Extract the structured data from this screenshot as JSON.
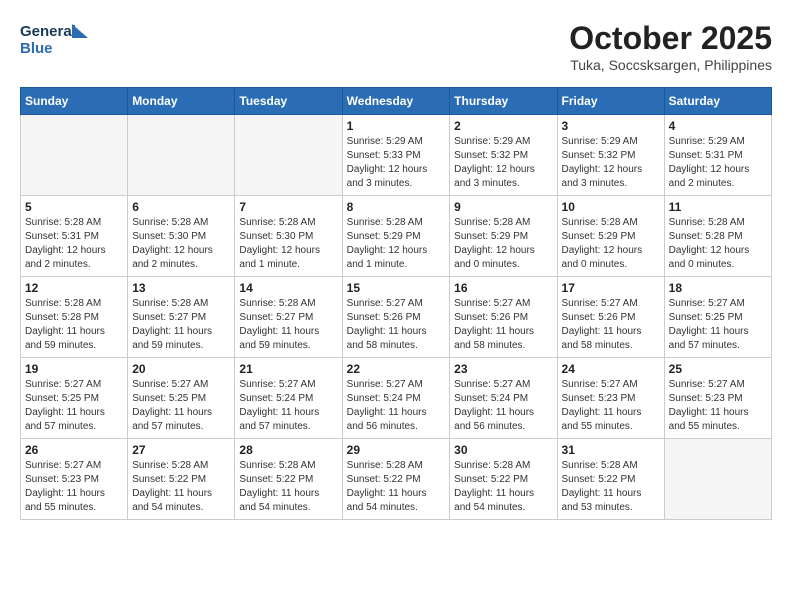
{
  "logo": {
    "line1": "General",
    "line2": "Blue"
  },
  "title": "October 2025",
  "subtitle": "Tuka, Soccsksargen, Philippines",
  "days_of_week": [
    "Sunday",
    "Monday",
    "Tuesday",
    "Wednesday",
    "Thursday",
    "Friday",
    "Saturday"
  ],
  "weeks": [
    [
      {
        "day": null,
        "info": null
      },
      {
        "day": null,
        "info": null
      },
      {
        "day": null,
        "info": null
      },
      {
        "day": "1",
        "info": "Sunrise: 5:29 AM\nSunset: 5:33 PM\nDaylight: 12 hours\nand 3 minutes."
      },
      {
        "day": "2",
        "info": "Sunrise: 5:29 AM\nSunset: 5:32 PM\nDaylight: 12 hours\nand 3 minutes."
      },
      {
        "day": "3",
        "info": "Sunrise: 5:29 AM\nSunset: 5:32 PM\nDaylight: 12 hours\nand 3 minutes."
      },
      {
        "day": "4",
        "info": "Sunrise: 5:29 AM\nSunset: 5:31 PM\nDaylight: 12 hours\nand 2 minutes."
      }
    ],
    [
      {
        "day": "5",
        "info": "Sunrise: 5:28 AM\nSunset: 5:31 PM\nDaylight: 12 hours\nand 2 minutes."
      },
      {
        "day": "6",
        "info": "Sunrise: 5:28 AM\nSunset: 5:30 PM\nDaylight: 12 hours\nand 2 minutes."
      },
      {
        "day": "7",
        "info": "Sunrise: 5:28 AM\nSunset: 5:30 PM\nDaylight: 12 hours\nand 1 minute."
      },
      {
        "day": "8",
        "info": "Sunrise: 5:28 AM\nSunset: 5:29 PM\nDaylight: 12 hours\nand 1 minute."
      },
      {
        "day": "9",
        "info": "Sunrise: 5:28 AM\nSunset: 5:29 PM\nDaylight: 12 hours\nand 0 minutes."
      },
      {
        "day": "10",
        "info": "Sunrise: 5:28 AM\nSunset: 5:29 PM\nDaylight: 12 hours\nand 0 minutes."
      },
      {
        "day": "11",
        "info": "Sunrise: 5:28 AM\nSunset: 5:28 PM\nDaylight: 12 hours\nand 0 minutes."
      }
    ],
    [
      {
        "day": "12",
        "info": "Sunrise: 5:28 AM\nSunset: 5:28 PM\nDaylight: 11 hours\nand 59 minutes."
      },
      {
        "day": "13",
        "info": "Sunrise: 5:28 AM\nSunset: 5:27 PM\nDaylight: 11 hours\nand 59 minutes."
      },
      {
        "day": "14",
        "info": "Sunrise: 5:28 AM\nSunset: 5:27 PM\nDaylight: 11 hours\nand 59 minutes."
      },
      {
        "day": "15",
        "info": "Sunrise: 5:27 AM\nSunset: 5:26 PM\nDaylight: 11 hours\nand 58 minutes."
      },
      {
        "day": "16",
        "info": "Sunrise: 5:27 AM\nSunset: 5:26 PM\nDaylight: 11 hours\nand 58 minutes."
      },
      {
        "day": "17",
        "info": "Sunrise: 5:27 AM\nSunset: 5:26 PM\nDaylight: 11 hours\nand 58 minutes."
      },
      {
        "day": "18",
        "info": "Sunrise: 5:27 AM\nSunset: 5:25 PM\nDaylight: 11 hours\nand 57 minutes."
      }
    ],
    [
      {
        "day": "19",
        "info": "Sunrise: 5:27 AM\nSunset: 5:25 PM\nDaylight: 11 hours\nand 57 minutes."
      },
      {
        "day": "20",
        "info": "Sunrise: 5:27 AM\nSunset: 5:25 PM\nDaylight: 11 hours\nand 57 minutes."
      },
      {
        "day": "21",
        "info": "Sunrise: 5:27 AM\nSunset: 5:24 PM\nDaylight: 11 hours\nand 57 minutes."
      },
      {
        "day": "22",
        "info": "Sunrise: 5:27 AM\nSunset: 5:24 PM\nDaylight: 11 hours\nand 56 minutes."
      },
      {
        "day": "23",
        "info": "Sunrise: 5:27 AM\nSunset: 5:24 PM\nDaylight: 11 hours\nand 56 minutes."
      },
      {
        "day": "24",
        "info": "Sunrise: 5:27 AM\nSunset: 5:23 PM\nDaylight: 11 hours\nand 55 minutes."
      },
      {
        "day": "25",
        "info": "Sunrise: 5:27 AM\nSunset: 5:23 PM\nDaylight: 11 hours\nand 55 minutes."
      }
    ],
    [
      {
        "day": "26",
        "info": "Sunrise: 5:27 AM\nSunset: 5:23 PM\nDaylight: 11 hours\nand 55 minutes."
      },
      {
        "day": "27",
        "info": "Sunrise: 5:28 AM\nSunset: 5:22 PM\nDaylight: 11 hours\nand 54 minutes."
      },
      {
        "day": "28",
        "info": "Sunrise: 5:28 AM\nSunset: 5:22 PM\nDaylight: 11 hours\nand 54 minutes."
      },
      {
        "day": "29",
        "info": "Sunrise: 5:28 AM\nSunset: 5:22 PM\nDaylight: 11 hours\nand 54 minutes."
      },
      {
        "day": "30",
        "info": "Sunrise: 5:28 AM\nSunset: 5:22 PM\nDaylight: 11 hours\nand 54 minutes."
      },
      {
        "day": "31",
        "info": "Sunrise: 5:28 AM\nSunset: 5:22 PM\nDaylight: 11 hours\nand 53 minutes."
      },
      {
        "day": null,
        "info": null
      }
    ]
  ]
}
